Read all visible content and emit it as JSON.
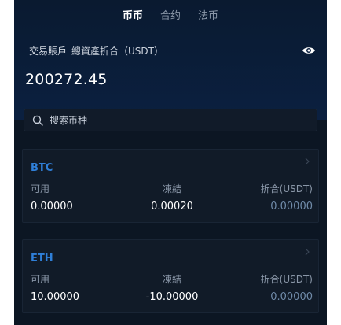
{
  "tabs": [
    {
      "label": "币币",
      "active": true
    },
    {
      "label": "合约",
      "active": false
    },
    {
      "label": "法币",
      "active": false
    }
  ],
  "account": {
    "title": "交易賬戶",
    "subtitle": "總資產折合（USDT）",
    "balance": "200272.45",
    "visibility_icon": "eye-icon"
  },
  "search": {
    "placeholder": "搜索币种",
    "icon": "search-icon"
  },
  "assets": [
    {
      "symbol": "BTC",
      "labels": {
        "available": "可用",
        "frozen": "凍結",
        "equiv": "折合(USDT)"
      },
      "available": "0.00000",
      "frozen": "0.00020",
      "equiv": "0.00000"
    },
    {
      "symbol": "ETH",
      "labels": {
        "available": "可用",
        "frozen": "凍結",
        "equiv": "折合(USDT)"
      },
      "available": "10.00000",
      "frozen": "-10.00000",
      "equiv": "0.00000"
    }
  ],
  "colors": {
    "background": "#0c1623",
    "header": "#0b2040",
    "symbol": "#2f7fd8",
    "muted": "#8a97a8"
  }
}
